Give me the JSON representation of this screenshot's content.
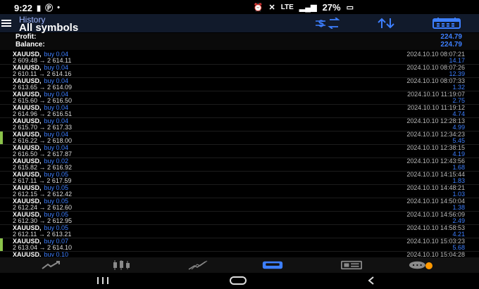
{
  "status": {
    "time": "9:22",
    "network": "LTE",
    "battery": "27%"
  },
  "header": {
    "subtitle": "History",
    "title": "All symbols",
    "icons": [
      "money-filter-icon",
      "sort-icon",
      "calendar-icon"
    ]
  },
  "summary": {
    "profit_label": "Profit:",
    "profit_value": "224.79",
    "balance_label": "Balance:",
    "balance_value": "224.79"
  },
  "trades": [
    {
      "symbol": "XAUUSD,",
      "type": "buy 0.04",
      "prices": "2 609.48 → 2 614.11",
      "time": "2024.10.10 08:07:21",
      "profit": "14.17",
      "marker": false
    },
    {
      "symbol": "XAUUSD,",
      "type": "buy 0.04",
      "prices": "2 610.11 → 2 614.16",
      "time": "2024.10.10 08:07:26",
      "profit": "12.39",
      "marker": false
    },
    {
      "symbol": "XAUUSD,",
      "type": "buy 0.04",
      "prices": "2 613.65 → 2 614.09",
      "time": "2024.10.10 08:07:33",
      "profit": "1.32",
      "marker": false
    },
    {
      "symbol": "XAUUSD,",
      "type": "buy 0.04",
      "prices": "2 615.60 → 2 616.50",
      "time": "2024.10.10 11:19:07",
      "profit": "2.75",
      "marker": false
    },
    {
      "symbol": "XAUUSD,",
      "type": "buy 0.04",
      "prices": "2 614.96 → 2 616.51",
      "time": "2024.10.10 11:19:12",
      "profit": "4.74",
      "marker": false
    },
    {
      "symbol": "XAUUSD,",
      "type": "buy 0.04",
      "prices": "2 615.70 → 2 617.33",
      "time": "2024.10.10 12:28:13",
      "profit": "4.99",
      "marker": false
    },
    {
      "symbol": "XAUUSD,",
      "type": "buy 0.04",
      "prices": "2 616.22 → 2 618.00",
      "time": "2024.10.10 12:34:23",
      "profit": "5.45",
      "marker": true
    },
    {
      "symbol": "XAUUSD,",
      "type": "buy 0.04",
      "prices": "2 616.50 → 2 617.87",
      "time": "2024.10.10 12:38:15",
      "profit": "4.19",
      "marker": false
    },
    {
      "symbol": "XAUUSD,",
      "type": "buy 0.02",
      "prices": "2 615.82 → 2 616.92",
      "time": "2024.10.10 12:43:56",
      "profit": "1.68",
      "marker": false
    },
    {
      "symbol": "XAUUSD,",
      "type": "buy 0.05",
      "prices": "2 617.11 → 2 617.59",
      "time": "2024.10.10 14:15:44",
      "profit": "1.83",
      "marker": false
    },
    {
      "symbol": "XAUUSD,",
      "type": "buy 0.05",
      "prices": "2 612.15 → 2 612.42",
      "time": "2024.10.10 14:48:21",
      "profit": "1.03",
      "marker": false
    },
    {
      "symbol": "XAUUSD,",
      "type": "buy 0.05",
      "prices": "2 612.24 → 2 612.60",
      "time": "2024.10.10 14:50:04",
      "profit": "1.38",
      "marker": false
    },
    {
      "symbol": "XAUUSD,",
      "type": "buy 0.05",
      "prices": "2 612.30 → 2 612.95",
      "time": "2024.10.10 14:56:09",
      "profit": "2.49",
      "marker": false
    },
    {
      "symbol": "XAUUSD,",
      "type": "buy 0.05",
      "prices": "2 612.11 → 2 613.21",
      "time": "2024.10.10 14:58:53",
      "profit": "4.21",
      "marker": false
    },
    {
      "symbol": "XAUUSD,",
      "type": "buy 0.07",
      "prices": "2 613.04 → 2 614.10",
      "time": "2024.10.10 15:03:23",
      "profit": "5.68",
      "marker": true
    },
    {
      "symbol": "XAUUSD,",
      "type": "buy 0.10",
      "prices": "",
      "time": "2024.10.10 15:04:28",
      "profit": "",
      "marker": false
    }
  ],
  "tabs": [
    "quotes-icon",
    "chart-icon",
    "trade-icon",
    "history-icon",
    "news-icon",
    "chat-icon"
  ],
  "colors": {
    "accent": "#3d7fff",
    "marker": "#8bc34a",
    "badge": "#ff9800"
  }
}
